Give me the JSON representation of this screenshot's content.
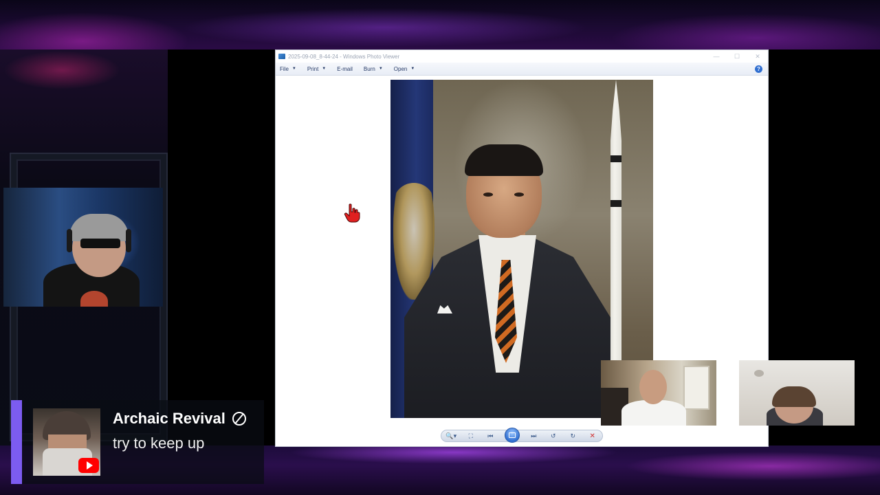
{
  "viewer": {
    "title": "2025-09-08_8-44-24 - Windows Photo Viewer",
    "controls": {
      "minimize": "—",
      "maximize": "☐",
      "close": "✕"
    },
    "menu": [
      {
        "label": "File",
        "has_caret": true
      },
      {
        "label": "Print",
        "has_caret": true
      },
      {
        "label": "E-mail",
        "has_caret": false
      },
      {
        "label": "Burn",
        "has_caret": true
      },
      {
        "label": "Open",
        "has_caret": true
      }
    ],
    "help_label": "?",
    "toolbar_icons": [
      "zoom-icon",
      "fit-window-icon",
      "previous-icon",
      "slideshow-icon",
      "next-icon",
      "rotate-left-icon",
      "rotate-right-icon",
      "delete-icon"
    ],
    "toolbar_glyphs": {
      "zoom": "🔍▾",
      "fit": "⛶",
      "prev": "⏮",
      "next": "⏭",
      "rotate_left": "↺",
      "rotate_right": "↻",
      "delete": "✕"
    }
  },
  "chat": {
    "author": "Archaic Revival",
    "message": "try to keep up",
    "accent_color": "#7c5cf0",
    "platform_icon": "youtube-icon"
  },
  "colors": {
    "brand_purple": "#7c5cf0",
    "youtube_red": "#ff0000",
    "viewer_bg": "#ffffff"
  }
}
